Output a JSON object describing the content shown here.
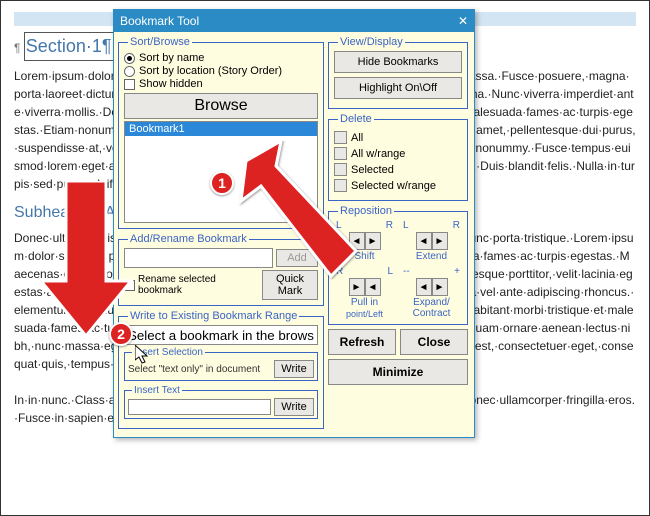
{
  "dialog": {
    "title": "Bookmark Tool",
    "close_glyph": "✕",
    "sort_browse": {
      "legend": "Sort/Browse",
      "sort_by_name": "Sort by name",
      "sort_by_location": "Sort by location (Story Order)",
      "show_hidden": "Show hidden",
      "browse_label": "Browse",
      "list_items": [
        "Bookmark1"
      ]
    },
    "add_rename": {
      "legend": "Add/Rename Bookmark",
      "add_label": "Add",
      "rename_checkbox": "Rename selected bookmark",
      "quick_mark": "Quick Mark"
    },
    "write_existing": {
      "legend": "Write to Existing Bookmark Range",
      "hint": "Select a bookmark in the browser to rename.",
      "insert_selection": {
        "legend": "Insert Selection",
        "hint": "Select \"text only\" in document",
        "write": "Write"
      },
      "insert_text": {
        "legend": "Insert Text",
        "write": "Write"
      }
    },
    "view_display": {
      "legend": "View/Display",
      "hide_bookmarks": "Hide Bookmarks",
      "highlight_toggle": "Highlight On\\Off"
    },
    "delete": {
      "legend": "Delete",
      "all": "All",
      "all_range": "All w/range",
      "selected": "Selected",
      "selected_range": "Selected w/range"
    },
    "reposition": {
      "legend": "Reposition",
      "L": "L",
      "R": "R",
      "minus": "--",
      "plus": "+",
      "shift": "Shift",
      "extend": "Extend",
      "pull_in": "Pull in",
      "point_left": "point/Left",
      "expand_contract": "Expand/\nContract"
    },
    "refresh": "Refresh",
    "close": "Close",
    "minimize": "Minimize"
  },
  "doc": {
    "section_heading": "Section·1¶",
    "subheading": "Subheading·A¶",
    "para1": "Lorem·ipsum·dolor·sit·amet,·consectetur·adipiscing·elit.·Proin·mollis·mi·eu·congue·massa.·Fusce·posuere,·magna·porta·laoreet·dictum,·arcu·tellus·malesuada·urna,·eget·commodo·magna·eros·quis·urna.·Nunc·viverra·imperdiet·ante·viverra·mollis.·Donec·nec·porta·ante·habitant·morbi·tristique·senectus·et·netus·et·malesuada·fames·ac·turpis·egestas.·Etiam·nonummy·pede.·Mauris·et·orci.·Aenean·nec·lorem.·Lorem·ipsum·dolor·sit·amet,·pellentesque·dui·purus,·suspendisse·at,·volutpat·ac,·sodales·vitae,·urna.·Donec·mollis·venenatis·eleifend.·Ut·nonummy.·Fusce·tempus·euismod·lorem·eget·aliquam.·Phasellus·magna.·Nulla·tincidunt·facilisis·ut,·porta·et,·diam.·Duis·blandit·felis.·Nulla·in·turpis·sed·purus·eleifend·tempus·ipsum·pretium·metus,·in·Similia¶",
    "para2": "Donec·ultrices·felis·volutpat·lorem·gravida,·et·ornare·arcu·volutpat.·Sed·at·lorem·in·nunc·porta·tristique.·Lorem·ipsum·dolor·sit·amet,·pellentesque·habitant·morbi·tristique·senectus·et·netus·et·malesuada·fames·ac·turpis·egestas.·Maecenas·odio·dolor,·vulputate·vel,·auctor·ac,·accumsan·id,·felis.·Ut·nonummy.·Pellentesque·porttitor,·velit·lacinia·egestas·auctor,·diam·eros·tempus·arcu,·nec·vulputate·augue·nisl·risus.·Cras·non·magna·vel·ante·adipiscing·rhoncus.·elementum·interdum·massa.·Integer·euismod·ultrices·ac·lobortis·eros.·Pellentesque·habitant·morbi·tristique·et·malesuada·fames·ac·turpis·egestas.·Proin·semper,·ante·vitae·sollicitudin·posuere,·metus·quam·ornare·aenean·lectus·nibh,·nunc·massa·eget·pede.·Sed·velit·urna,·interdum·vel,·ultricies·vel,·facilisis·elit·erat·est,·consectetuer·eget,·consequat·quis,·tempus·quis,·wisi.¶",
    "para3": "In·in·nunc.·Class·aptent·taciti·sociosqu·ad·litora·torquent·per·inceptos·hymenaeos.·Donec·ullamcorper·fringilla·eros.·Fusce·in·sapien·eu·purus·dapibus·commodo.·Cum·sociis·natoque·"
  },
  "callouts": {
    "one": "1",
    "two": "2"
  }
}
